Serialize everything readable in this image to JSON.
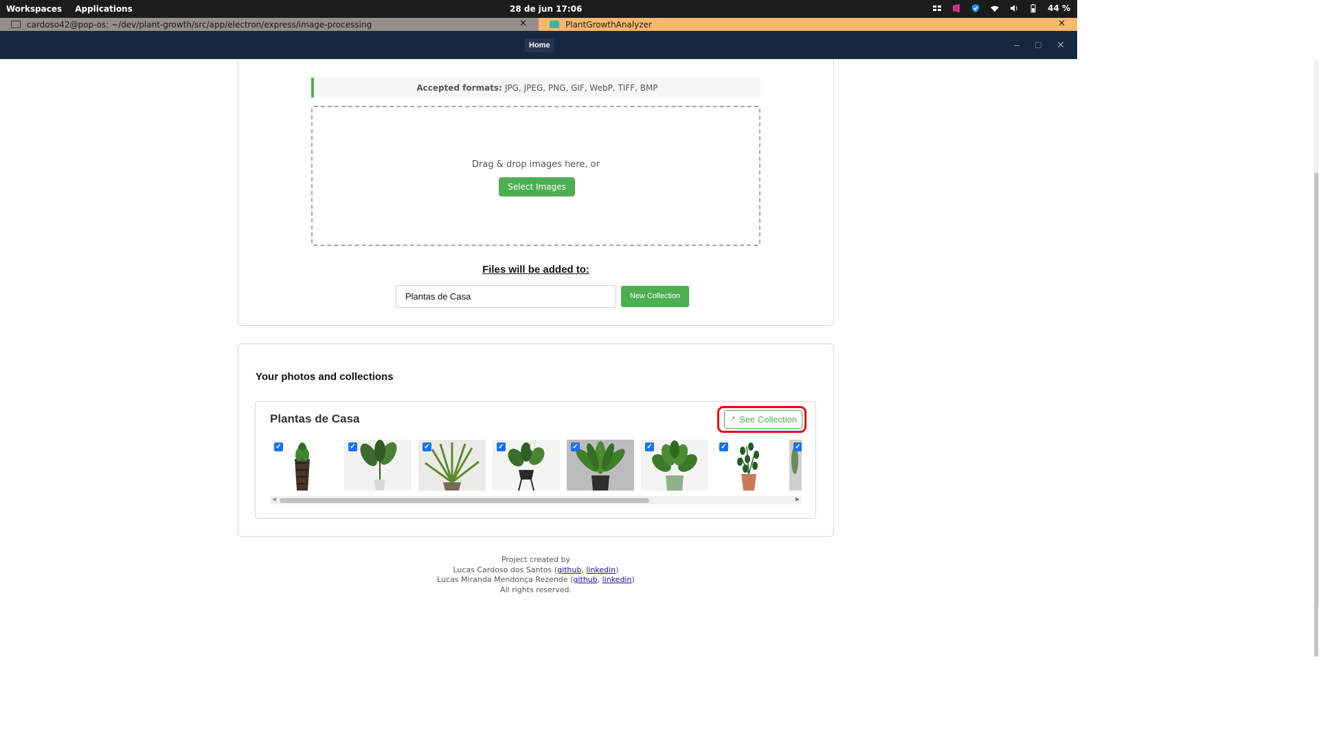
{
  "system_bar": {
    "workspaces": "Workspaces",
    "applications": "Applications",
    "clock": "28 de jun  17:06",
    "battery": "44 %"
  },
  "tabs": [
    {
      "label": "cardoso42@pop-os: ~/dev/plant-growth/src/app/electron/express/image-processing",
      "close": "✕"
    },
    {
      "label": "PlantGrowthAnalyzer",
      "close": "✕"
    }
  ],
  "window": {
    "home_label": "Home",
    "minimize": "–",
    "maximize": "□",
    "close": "✕"
  },
  "upload": {
    "formats_label": "Accepted formats:",
    "formats_value": "JPG, JPEG, PNG, GIF, WebP, TIFF, BMP",
    "drop_text": "Drag & drop images here, or",
    "select_button": "Select Images",
    "added_title": "Files will be added to:",
    "collection_value": "Plantas de Casa",
    "new_collection_button": "New Collection"
  },
  "collections": {
    "section_title": "Your photos and collections",
    "items": [
      {
        "name": "Plantas de Casa",
        "see_button": "See Collection",
        "photos": [
          {
            "checked": true,
            "plant": "snake-plant-tall-pot"
          },
          {
            "checked": true,
            "plant": "bird-of-paradise"
          },
          {
            "checked": true,
            "plant": "palm"
          },
          {
            "checked": true,
            "plant": "peace-lily-stand"
          },
          {
            "checked": true,
            "plant": "birds-nest-fern"
          },
          {
            "checked": true,
            "plant": "peace-lily"
          },
          {
            "checked": true,
            "plant": "zz-plant"
          },
          {
            "checked": true,
            "plant": "partial"
          }
        ]
      }
    ]
  },
  "footer": {
    "line1": "Project created by",
    "author1": "Lucas Cardoso dos Santos",
    "author2": "Lucas Miranda Mendonça Rezende",
    "github": "github",
    "linkedin": "linkedin",
    "rights": "All rights reserved."
  },
  "colors": {
    "accent_green": "#4caf50",
    "header_navy": "#162740",
    "highlight_red": "#e00d0d",
    "app_tab": "#fbb86c"
  }
}
